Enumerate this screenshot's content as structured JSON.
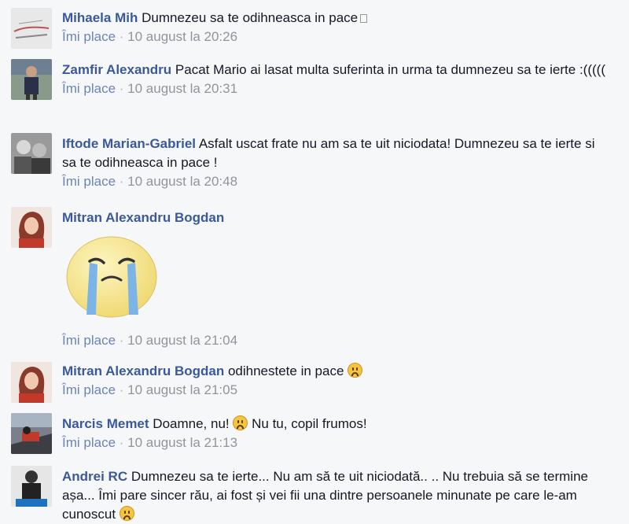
{
  "like_label": "Îmi place",
  "separator": "·",
  "comments": [
    {
      "author": "Mihaela Mih",
      "text": "Dumnezeu sa te odihneasca in pace",
      "time": "10 august la 20:26"
    },
    {
      "author": "Zamfir Alexandru",
      "text": "Pacat Mario ai lasat multa suferinta in urma ta dumnezeu sa te ierte :(((((",
      "time": "10 august la 20:31"
    },
    {
      "author": "Iftode Marian-Gabriel",
      "text": "Asfalt uscat frate nu am sa te uit niciodata! Dumnezeu sa te ierte si sa te odihneasca in pace !",
      "time": "10 august la 20:48"
    },
    {
      "author": "Mitran Alexandru Bogdan",
      "text": "",
      "time": "10 august la 21:04"
    },
    {
      "author": "Mitran Alexandru Bogdan",
      "text": "odihnestete in pace",
      "time": "10 august la 21:05"
    },
    {
      "author": "Narcis Memet",
      "text": "Doamne, nu!",
      "text2": "Nu tu, copil frumos!",
      "time": "10 august la 21:13"
    },
    {
      "author": "Andrei RC",
      "text": "Dumnezeu sa te ierte... Nu am să te uit niciodată.. .. Nu trebuia să se termine așa... Îmi pare sincer rău, ai fost și vei fii una dintre persoanele minunate pe care le-am cunoscut"
    }
  ],
  "icons": {
    "missing_glyph": "missing-glyph-icon",
    "sad_emoticon": "sad-emoticon",
    "crying_sticker": "crying-face-sticker"
  }
}
